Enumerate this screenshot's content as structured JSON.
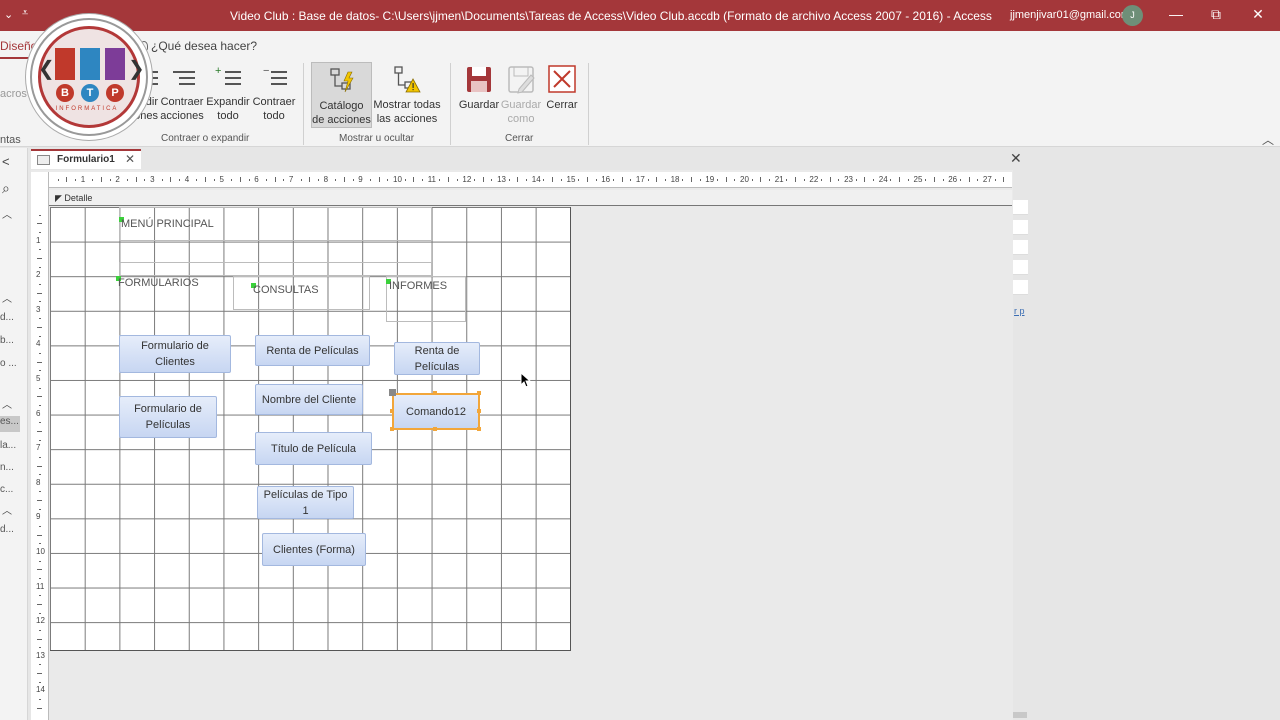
{
  "titlebar": {
    "quick_access_1": "⌄",
    "quick_access_2": "⩡",
    "title": "Video Club : Base de datos- C:\\Users\\jjmen\\Documents\\Tareas de Access\\Video Club.accdb (Formato de archivo Access 2007 - 2016)  -  Access",
    "user_email": "jjmenjivar01@gmail.com",
    "avatar_letter": "J",
    "minimize": "—",
    "restore": "⧉",
    "close": "✕"
  },
  "ribbon": {
    "active_tab": "Diseño",
    "tell_me": "¿Qué desea hacer?",
    "partial_left_1": "acros",
    "partial_left_2": "ntas",
    "buttons": {
      "expand_actions_line1": "ndir",
      "expand_actions_line2": "ones",
      "collapse_actions_line1": "Contraer",
      "collapse_actions_line2": "acciones",
      "expand_all_line1": "Expandir",
      "expand_all_line2": "todo",
      "collapse_all_line1": "Contraer",
      "collapse_all_line2": "todo",
      "action_catalog_line1": "Catálogo",
      "action_catalog_line2": "de acciones",
      "show_all_actions_line1": "Mostrar todas",
      "show_all_actions_line2": "las acciones",
      "save": "Guardar",
      "save_as_line1": "Guardar",
      "save_as_line2": "como",
      "close": "Cerrar"
    },
    "groups": {
      "collapse_expand": "Contraer o expandir",
      "show_hide": "Mostrar u ocultar",
      "close": "Cerrar"
    },
    "collapse_ribbon": "︿"
  },
  "logo": {
    "letters": [
      "B",
      "T",
      "P"
    ],
    "subtitle": "INFORMATICA"
  },
  "nav_pane": {
    "back": "<",
    "search": "⌕",
    "items": [
      "d...",
      "b...",
      "o ...",
      "es...",
      "la...",
      "n...",
      "c...",
      "d..."
    ]
  },
  "document": {
    "tab_label": "Formulario1",
    "tab_close": "✕",
    "window_close": "✕",
    "section_label": "Detalle",
    "right_link": "r p"
  },
  "form": {
    "labels": {
      "main_menu": "MENÚ PRINCIPAL",
      "forms": "FORMULARIOS",
      "queries": "CONSULTAS",
      "reports": "INFORMES"
    },
    "buttons": {
      "clients_form": "Formulario de Clientes",
      "movies_form": "Formulario de Películas",
      "movie_rentals_query": "Renta de Películas",
      "client_name_query": "Nombre del Cliente",
      "movie_title_query": "Título de Película",
      "type1_movies_query": "Películas de Tipo 1",
      "clients_form_query": "Clientes (Forma)",
      "movie_rentals_report": "Renta de Películas",
      "command12": "Comando12"
    }
  },
  "rulers": {
    "horizontal": [
      "1",
      "2",
      "3",
      "4",
      "5",
      "6",
      "7",
      "8",
      "9",
      "10",
      "11",
      "12",
      "13",
      "14",
      "15",
      "16",
      "17",
      "18",
      "19",
      "20",
      "21",
      "22",
      "23",
      "24",
      "25",
      "26",
      "27"
    ],
    "vertical": [
      "1",
      "2",
      "3",
      "4",
      "5",
      "6",
      "7",
      "8",
      "9",
      "10",
      "11",
      "12",
      "13",
      "14"
    ]
  }
}
